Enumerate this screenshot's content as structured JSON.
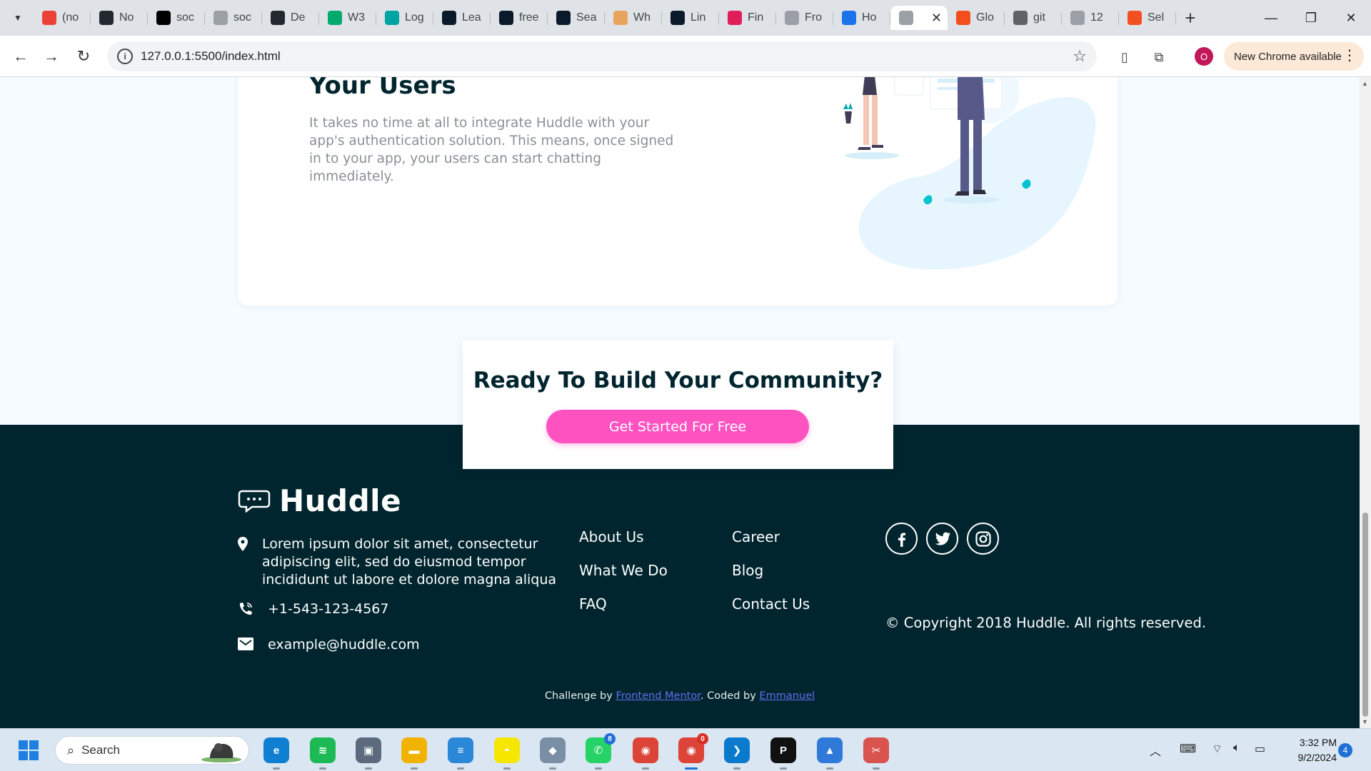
{
  "browser": {
    "tabs": [
      {
        "label": "(no",
        "icon": "gmail-icon",
        "color": "#ea4335"
      },
      {
        "label": "No",
        "icon": "github-icon",
        "color": "#24292f"
      },
      {
        "label": "soc",
        "icon": "vercel-icon",
        "color": "#000000"
      },
      {
        "label": "soc",
        "icon": "page-icon",
        "color": "#9aa0a6"
      },
      {
        "label": "De",
        "icon": "github-icon",
        "color": "#24292f"
      },
      {
        "label": "W3",
        "icon": "w3schools-icon",
        "color": "#04aa6d"
      },
      {
        "label": "Log",
        "icon": "diamond-icon",
        "color": "#00a3a3"
      },
      {
        "label": "Lea",
        "icon": "frontend-mentor-icon",
        "color": "#0a1a2a"
      },
      {
        "label": "free",
        "icon": "frontend-mentor-icon",
        "color": "#0a1a2a"
      },
      {
        "label": "Sea",
        "icon": "frontend-mentor-icon",
        "color": "#0a1a2a"
      },
      {
        "label": "Wh",
        "icon": "hand-icon",
        "color": "#e8a35c"
      },
      {
        "label": "Lin",
        "icon": "frontend-mentor-icon",
        "color": "#0a1a2a"
      },
      {
        "label": "Fin",
        "icon": "slack-icon",
        "color": "#e01e5a"
      },
      {
        "label": "Fro",
        "icon": "page-icon",
        "color": "#9aa0a6"
      },
      {
        "label": "Ho",
        "icon": "flag-icon",
        "color": "#1a73e8"
      },
      {
        "label": "",
        "icon": "page-icon",
        "color": "#9aa0a6",
        "active": true
      },
      {
        "label": "Glo",
        "icon": "figma-icon",
        "color": "#f24e1e"
      },
      {
        "label": "git",
        "icon": "globe-icon",
        "color": "#5f6368"
      },
      {
        "label": "12",
        "icon": "page-icon",
        "color": "#9aa0a6"
      },
      {
        "label": "Sel",
        "icon": "microsoft-icon",
        "color": "#f25022"
      }
    ],
    "url": "127.0.0.1:5500/index.html",
    "profile_initial": "O",
    "update_chip": "New Chrome available"
  },
  "page": {
    "feature_title": "Your Users",
    "feature_text": "It takes no time at all to integrate Huddle with your app's authentication solution. This means, once signed in to your app, your users can start chatting immediately.",
    "cta_title": "Ready To Build Your Community?",
    "cta_button": "Get Started For Free",
    "footer": {
      "logo_text": "Huddle",
      "address": "Lorem ipsum dolor sit amet, consectetur adipiscing elit, sed do eiusmod tempor incididunt ut labore et dolore magna aliqua",
      "phone": "+1-543-123-4567",
      "email": "example@huddle.com",
      "links_col1": [
        "About Us",
        "What We Do",
        "FAQ"
      ],
      "links_col2": [
        "Career",
        "Blog",
        "Contact Us"
      ],
      "socials": [
        "facebook-icon",
        "twitter-icon",
        "instagram-icon"
      ],
      "copyright": "© Copyright 2018 Huddle. All rights reserved.",
      "attribution": {
        "prefix": "Challenge by ",
        "link1": "Frontend Mentor",
        "middle": ". Coded by ",
        "link2": "Emmanuel"
      }
    }
  },
  "taskbar": {
    "search_placeholder": "Search",
    "apps": [
      {
        "name": "edge-icon",
        "color": "#0f7fd1",
        "glyph": "e"
      },
      {
        "name": "spotify-icon",
        "color": "#1db954",
        "glyph": "≋"
      },
      {
        "name": "preview-icon",
        "color": "#5b6b7d",
        "glyph": "▣"
      },
      {
        "name": "file-explorer-icon",
        "color": "#f2b300",
        "glyph": "▬"
      },
      {
        "name": "notepad-icon",
        "color": "#2b88d8",
        "glyph": "≡"
      },
      {
        "name": "snapchat-icon",
        "color": "#f7e600",
        "glyph": "◓"
      },
      {
        "name": "app-icon",
        "color": "#7a8ea6",
        "glyph": "◆"
      },
      {
        "name": "whatsapp-icon",
        "color": "#25d366",
        "glyph": "✆",
        "badge": "8"
      },
      {
        "name": "chrome-icon",
        "color": "#db4437",
        "glyph": "◉"
      },
      {
        "name": "chrome-profile-icon",
        "color": "#db4437",
        "glyph": "◉",
        "badge": "0",
        "active": true
      },
      {
        "name": "vscode-icon",
        "color": "#0a7acc",
        "glyph": "❯"
      },
      {
        "name": "jetbrains-icon",
        "color": "#111111",
        "glyph": "P"
      },
      {
        "name": "photos-icon",
        "color": "#2f7ad9",
        "glyph": "▲"
      },
      {
        "name": "snipping-tool-icon",
        "color": "#d9534f",
        "glyph": "✂"
      }
    ],
    "time": "3:32 PM",
    "date": "9/2/2024",
    "notification_count": "4"
  }
}
